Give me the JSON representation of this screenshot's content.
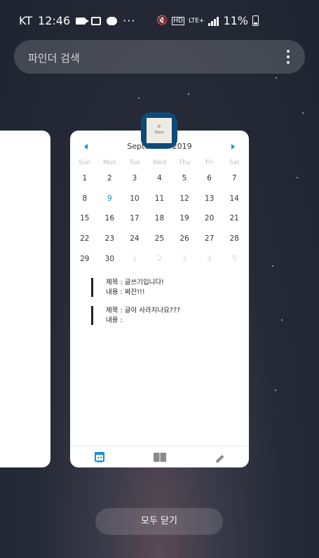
{
  "status_bar": {
    "carrier": "KT",
    "time": "12:46",
    "overflow": "···",
    "network": "LTE+",
    "battery": "11%",
    "icons": [
      "video-icon",
      "gallery-icon",
      "talk-icon",
      "mute-icon",
      "hd-icon",
      "signal-icon",
      "battery-icon"
    ]
  },
  "search": {
    "placeholder": "파인더 검색"
  },
  "app": {
    "icon_text": [
      "IP",
      "Diary"
    ],
    "calendar": {
      "month_label": "September 2019",
      "weekdays": [
        "Sun",
        "Mon",
        "Tue",
        "Wed",
        "Thu",
        "Fri",
        "Sat"
      ],
      "weeks": [
        [
          "1",
          "2",
          "3",
          "4",
          "5",
          "6",
          "7"
        ],
        [
          "8",
          "9",
          "10",
          "11",
          "12",
          "13",
          "14"
        ],
        [
          "15",
          "16",
          "17",
          "18",
          "19",
          "20",
          "21"
        ],
        [
          "22",
          "23",
          "24",
          "25",
          "26",
          "27",
          "28"
        ],
        [
          "29",
          "30",
          "1",
          "2",
          "3",
          "4",
          "5"
        ]
      ],
      "selected": "9",
      "accent": "#1a8fd6"
    },
    "memos": [
      {
        "title": "제목 : 글쓰기입니다!",
        "content": "내용 : 짜잔!!!"
      },
      {
        "title": "제목 : 글이 사라지나요???",
        "content": "내용 :"
      }
    ],
    "toolbar": [
      "calendar-icon",
      "book-icon",
      "pencil-icon"
    ]
  },
  "close_all": {
    "label": "모두 닫기"
  }
}
